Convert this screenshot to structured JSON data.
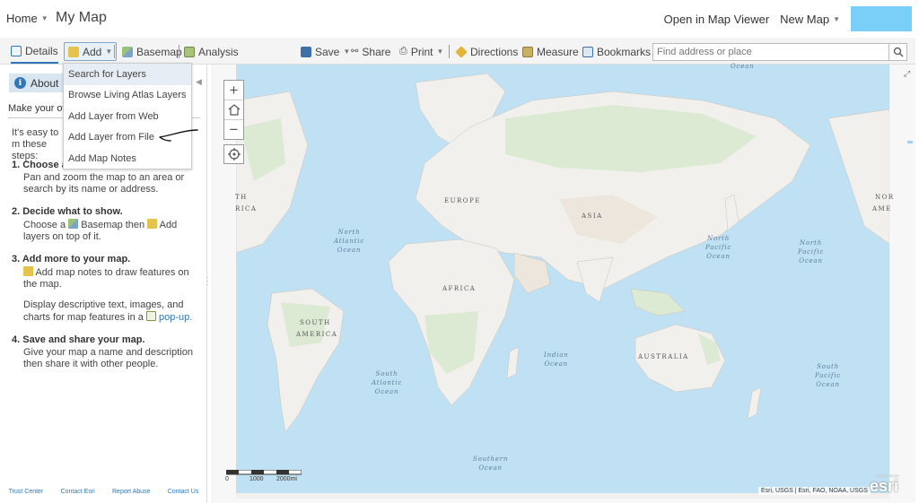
{
  "header": {
    "home_label": "Home",
    "map_title": "My Map",
    "open_map_viewer": "Open in Map Viewer",
    "new_map_label": "New Map"
  },
  "toolbar": {
    "details_label": "Details",
    "add_label": "Add",
    "basemap_label": "Basemap",
    "analysis_label": "Analysis",
    "save_label": "Save",
    "share_label": "Share",
    "print_label": "Print",
    "directions_label": "Directions",
    "measure_label": "Measure",
    "bookmarks_label": "Bookmarks",
    "search_placeholder": "Find address or place"
  },
  "add_menu": {
    "items": [
      "Search for Layers",
      "Browse Living Atlas Layers",
      "Add Layer from Web",
      "Add Layer from File",
      "Add Map Notes"
    ],
    "highlighted_index": 0
  },
  "sidebar": {
    "about_label": "About",
    "make_your": "Make your ow",
    "intro": "It's easy to m these steps:",
    "steps": [
      {
        "heading": "1. Choose ar",
        "body": "Pan and zoom the map to an area or search by its name or address."
      },
      {
        "heading": "2. Decide what to show.",
        "body_a": "Choose a",
        "basemap_word": "Basemap then",
        "add_word": "Add layers",
        "body_b": "on top of it."
      },
      {
        "heading": "3. Add more to your map.",
        "body_a": "Add map notes to draw features on the map.",
        "body_b": "Display descriptive text, images, and charts for map features in a",
        "popup": "pop-up."
      },
      {
        "heading": "4. Save and share your map.",
        "body": "Give your map a name and description then share it with other people."
      }
    ],
    "footer": [
      "Trust Center",
      "Contact Esri",
      "Report Abuse",
      "Contact Us"
    ]
  },
  "map": {
    "continents": [
      "EUROPE",
      "ASIA",
      "AFRICA",
      "SOUTH",
      "AMERICA",
      "AUSTRALIA",
      "TH",
      "RICA",
      "NOR",
      "AME"
    ],
    "oceans": {
      "north_atlantic": [
        "North",
        "Atlantic",
        "Ocean"
      ],
      "north_pacific": [
        "North",
        "Pacific",
        "Ocean"
      ],
      "north_pacific_east": [
        "North",
        "Pacific",
        "Ocean"
      ],
      "indian": [
        "Indian",
        "Ocean"
      ],
      "south_atlantic": [
        "South",
        "Atlantic",
        "Ocean"
      ],
      "south_pacific": [
        "South",
        "Pacific",
        "Ocean"
      ],
      "southern": [
        "Southern",
        "Ocean"
      ],
      "top_ocean": "Ocean"
    },
    "scale": [
      "0",
      "1000",
      "2000mi"
    ],
    "attribution": "Esri, USGS | Esri, FAO, NOAA, USGS",
    "esri_logo": "esri",
    "powered_by": "POWERED BY"
  },
  "colors": {
    "accent": "#2f77b8",
    "ocean": "#bfe1f3",
    "land": "#f2f0ec",
    "vegetation": "#dcead3",
    "user_box": "#79cff7"
  }
}
